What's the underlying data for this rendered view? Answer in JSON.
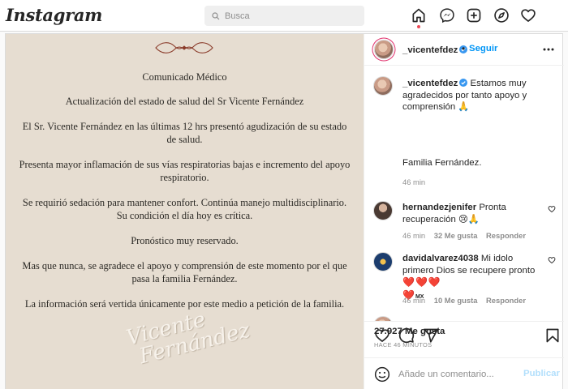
{
  "header": {
    "logo": "Instagram",
    "search_placeholder": "Busca",
    "nav_icons": [
      "home-icon",
      "messenger-icon",
      "new-post-icon",
      "explore-icon",
      "activity-icon"
    ]
  },
  "post": {
    "author": "_vicentefdez",
    "follow_label": "Seguir",
    "image": {
      "title": "Comunicado Médico",
      "paragraphs": [
        "Actualización del estado de salud del Sr Vicente Fernández",
        "El Sr. Vicente Fernández en las últimas 12 hrs presentó agudización de su estado de salud.",
        "Presenta mayor inflamación de sus vías respiratorias bajas e incremento del apoyo respiratorio.",
        "Se requirió sedación para mantener confort. Continúa manejo multidisciplinario. Su condición el día hoy es crítica.",
        "Pronóstico muy reservado.",
        "Mas que nunca, se agradece el apoyo y comprensión de este momento por el que pasa la familia Fernández.",
        "La información será vertida únicamente por este medio a petición de la familia."
      ],
      "signature": [
        "Vicente",
        "Fernández"
      ]
    },
    "caption": {
      "author": "_vicentefdez",
      "text": "Estamos muy agradecidos por tanto apoyo y comprensión 🙏",
      "family": "Familia Fernández.",
      "time": "46 min"
    },
    "comments": [
      {
        "author": "hernandezjenifer",
        "text": "Pronta recuperación 😢🙏",
        "time": "46 min",
        "likes": "32 Me gusta",
        "reply": "Responder"
      },
      {
        "author": "davidalvarez4038",
        "text": "Mi idolo primero Dios se recupere pronto",
        "hearts": "❤️❤️❤️",
        "hearts2": "❤️",
        "flag": "MX",
        "time": "46 min",
        "likes": "10 Me gusta",
        "reply": "Responder"
      }
    ],
    "likes": "27.927 Me gusta",
    "ago": "HACE 46 MINUTOS",
    "comment_placeholder": "Añade un comentario...",
    "publish_label": "Publicar"
  },
  "colors": {
    "accent": "#0095f6",
    "like_red": "#ed4956",
    "image_bg": "#e6ddd1"
  }
}
